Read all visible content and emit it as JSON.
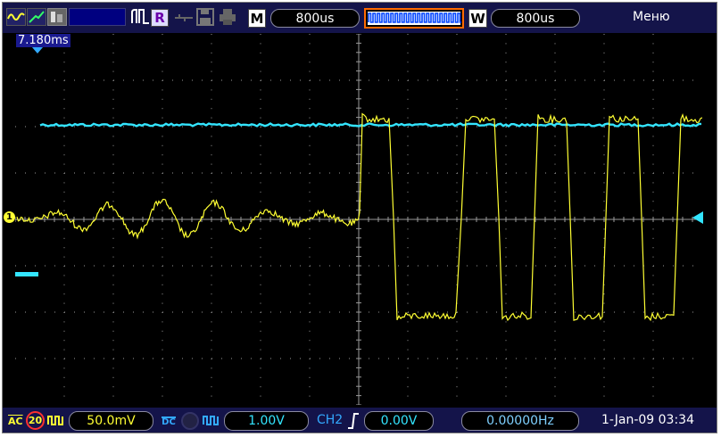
{
  "top_bar": {
    "mode_letter": "M",
    "timebase": "800us",
    "window_letter": "W",
    "window_timebase": "800us",
    "run_letter": "R",
    "menu_label": "Меню"
  },
  "trigger_offset": "7.180ms",
  "bottom_bar": {
    "ch1_coupling": "AC",
    "ch1_bw_limit": "20",
    "ch1_scale": "50.0mV",
    "ch2_coupling": "DC",
    "ch2_scale": "1.00V",
    "trigger_source": "CH2",
    "trigger_level": "0.00V",
    "frequency": "0.00000Hz",
    "datetime": "1-Jan-09 03:34"
  },
  "colors": {
    "ch1": "#ffff33",
    "ch2": "#33e5ff",
    "bar_bg": "#14144a",
    "grid": "#9a9a9a"
  }
}
